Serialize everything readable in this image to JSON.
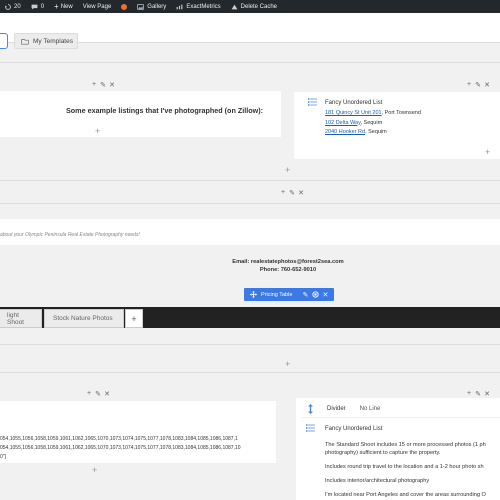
{
  "admin_bar": {
    "update_count": "20",
    "comment_count": "0",
    "new_label": "New",
    "view_page_label": "View Page",
    "gallery_label": "Gallery",
    "exactmetrics_label": "ExactMetrics",
    "delete_cache_label": "Delete Cache"
  },
  "top_tabs": {
    "my_templates_label": "My Templates"
  },
  "row1": {
    "heading": "Some example listings that I've photographed (on Zillow):"
  },
  "fancy_list_1": {
    "title": "Fancy Unordered List",
    "items": [
      {
        "link": "181 Quincy St Unit 201",
        "rest": ", Port Townsend"
      },
      {
        "link": "102 Delta Way",
        "rest": ", Sequim"
      },
      {
        "link": "2040 Hooker Rd",
        "rest": ", Sequim"
      }
    ]
  },
  "row2": {
    "italic_text": "about your Olympic Peninsula Real Estate Photography needs!",
    "email_line": "Email: realestatephotos@forest2sea.com",
    "phone_line": "Phone: 760-652-9010"
  },
  "pricing_toolbar": {
    "label": "Pricing Table"
  },
  "pricing_tabs": [
    {
      "label": "light Shoot"
    },
    {
      "label": "Stock Nature Photos"
    }
  ],
  "ids_box": {
    "lines": [
      "054,1055,1056,1058,1059,1061,1062,1065,1070,1073,1074,1075,1077,1078,1083,1084,1085,1086,1087,1",
      "054,1055,1056,1058,1059,1061,1062,1065,1070,1073,1074,1075,1077,1078,1083,1084,1085,1086,1087,10",
      "0\"]"
    ]
  },
  "right_panel": {
    "divider_label": "Divider",
    "divider_value": "No Line",
    "list_title": "Fancy Unordered List",
    "paragraphs": [
      "The Standard Shoot includes 15 or more processed photos (1 ph",
      "photography) sufficient to capture the property.",
      "Includes round trip travel to the location and a 1-2 hour photo sh",
      "Includes interior/architectural photography",
      "I'm located near Port Angeles and cover the areas surrounding O"
    ]
  },
  "icons": {
    "add": "plus-icon",
    "edit": "pencil-icon",
    "remove": "close-icon"
  },
  "colors": {
    "admin_bar": "#23282d",
    "accent_blue": "#3a79e6",
    "dark_bar": "#222222",
    "link": "#1a5fb4"
  }
}
